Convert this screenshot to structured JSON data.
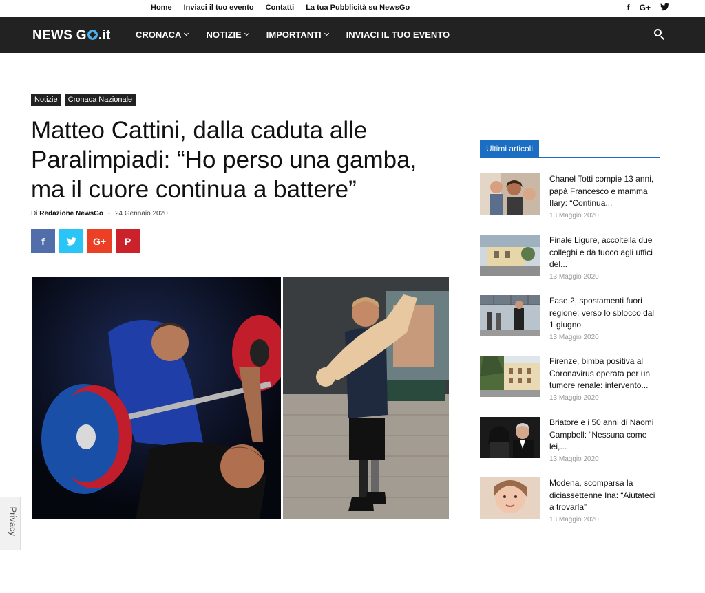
{
  "topbar": {
    "menu": [
      "Home",
      "Inviaci il tuo evento",
      "Contatti",
      "La tua Pubblicità su NewsGo"
    ],
    "social": [
      "f",
      "G+",
      "twitter"
    ]
  },
  "nav": {
    "logo_pre": "NEWS G",
    "logo_post": ".it",
    "items": [
      "CRONACA",
      "NOTIZIE",
      "IMPORTANTI",
      "INVIACI IL TUO EVENTO"
    ]
  },
  "article": {
    "categories": [
      "Notizie",
      "Cronaca Nazionale"
    ],
    "title": "Matteo Cattini, dalla caduta alle Paralimpiadi: “Ho perso una gamba, ma il cuore continua a battere”",
    "by": "Di",
    "author": "Redazione NewsGo",
    "date": "24 Gennaio 2020",
    "share": [
      "f",
      "t",
      "G+",
      "P"
    ]
  },
  "privacy": "Privacy",
  "sidebar": {
    "heading": "Ultimi articoli",
    "items": [
      {
        "title": "Chanel Totti compie 13 anni, papà Francesco e mamma Ilary: “Continua...",
        "date": "13 Maggio 2020"
      },
      {
        "title": "Finale Ligure, accoltella due colleghi e dà fuoco agli uffici del...",
        "date": "13 Maggio 2020"
      },
      {
        "title": "Fase 2, spostamenti fuori regione: verso lo sblocco dal 1 giugno",
        "date": "13 Maggio 2020"
      },
      {
        "title": "Firenze, bimba positiva al Coronavirus operata per un tumore renale: intervento...",
        "date": "13 Maggio 2020"
      },
      {
        "title": "Briatore e i 50 anni di Naomi Campbell: “Nessuna come lei,...",
        "date": "13 Maggio 2020"
      },
      {
        "title": "Modena, scomparsa la diciassettenne Ina: “Aiutateci a trovarla”",
        "date": "13 Maggio 2020"
      }
    ]
  }
}
